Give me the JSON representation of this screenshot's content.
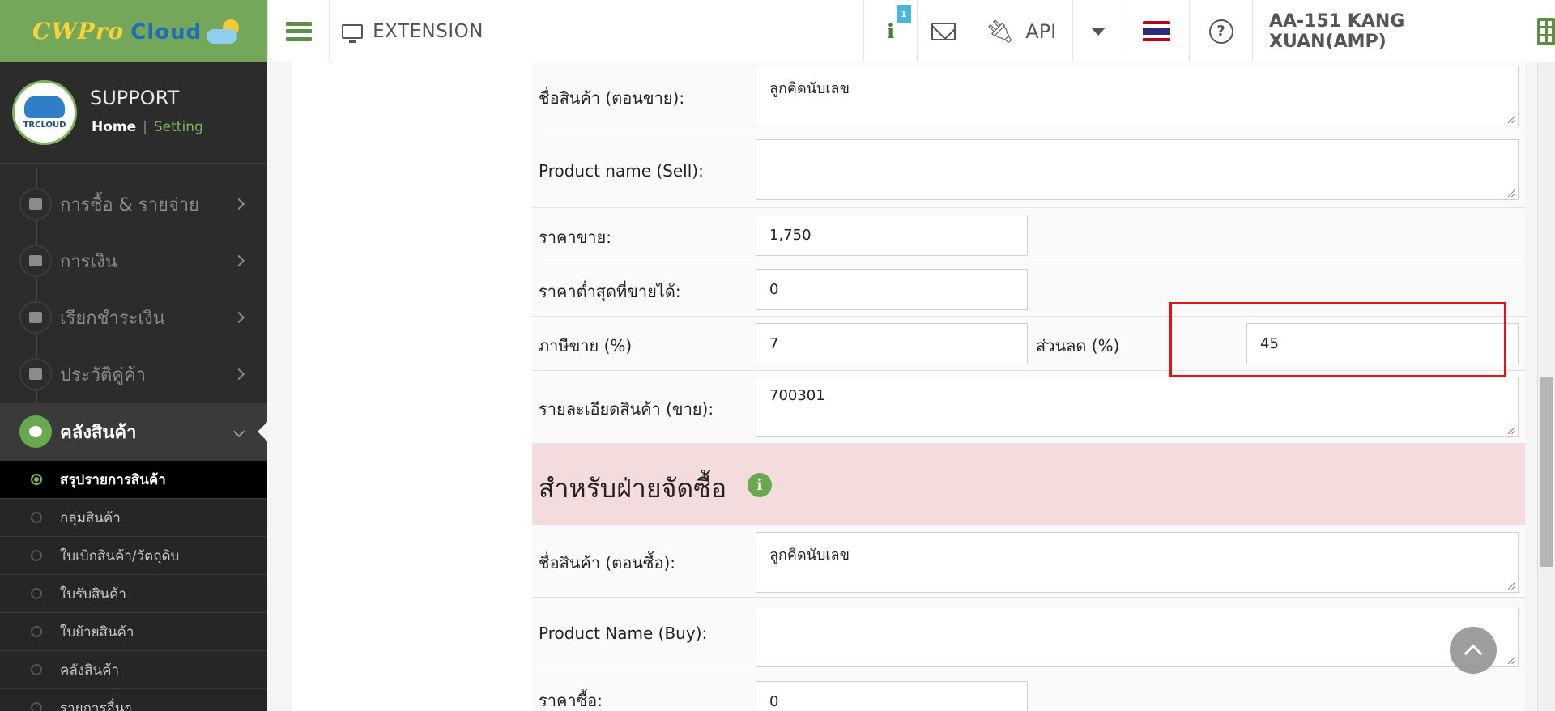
{
  "topbar": {
    "logo_text": "CWPro",
    "logo_cloud": "Cloud",
    "extension_label": "EXTENSION",
    "info_badge": "1",
    "api_label": "API",
    "user_label": "AA-151 KANG XUAN(AMP)",
    "flag_colors": [
      "#b8001f",
      "#ffffff",
      "#2d2a7a",
      "#ffffff",
      "#b8001f"
    ]
  },
  "sidebar": {
    "profile_name": "SUPPORT",
    "home_link": "Home",
    "separator": "|",
    "setting_link": "Setting",
    "avatar_text": "TRCLOUD",
    "menu": [
      {
        "label": "การซื้อ & รายจ่าย"
      },
      {
        "label": "การเงิน"
      },
      {
        "label": "เรียกชำระเงิน"
      },
      {
        "label": "ประวัติคู่ค้า"
      },
      {
        "label": "คลังสินค้า"
      }
    ],
    "submenu": [
      {
        "label": "สรุปรายการสินค้า"
      },
      {
        "label": "กลุ่มสินค้า"
      },
      {
        "label": "ใบเบิกสินค้า/วัตถุดิบ"
      },
      {
        "label": "ใบรับสินค้า"
      },
      {
        "label": "ใบย้ายสินค้า"
      },
      {
        "label": "คลังสินค้า"
      },
      {
        "label": "รายการอื่นๆ"
      }
    ]
  },
  "form": {
    "sell_name_th_label": "ชื่อสินค้า (ตอนขาย):",
    "sell_name_th_value": "ลูกคิดนับเลข",
    "sell_name_en_label": "Product name (Sell):",
    "sell_name_en_value": "",
    "sell_price_label": "ราคาขาย:",
    "sell_price_value": "1,750",
    "min_price_label": "ราคาต่ำสุดที่ขายได้:",
    "min_price_value": "0",
    "sell_tax_label": "ภาษีขาย (%)",
    "sell_tax_value": "7",
    "discount_label": "ส่วนลด (%)",
    "discount_value": "45",
    "sell_detail_label": "รายละเอียดสินค้า (ขาย):",
    "sell_detail_value": "700301",
    "purchase_section_title": "สำหรับฝ่ายจัดซื้อ",
    "buy_name_th_label": "ชื่อสินค้า (ตอนซื้อ):",
    "buy_name_th_value": "ลูกคิดนับเลข",
    "buy_name_en_label": "Product Name (Buy):",
    "buy_name_en_value": "",
    "buy_price_label": "ราคาซื้อ:",
    "buy_price_value": "0"
  },
  "colors": {
    "brand_green": "#74a75a",
    "highlight_red": "#e01414",
    "section_band": "#f4dcdc"
  }
}
